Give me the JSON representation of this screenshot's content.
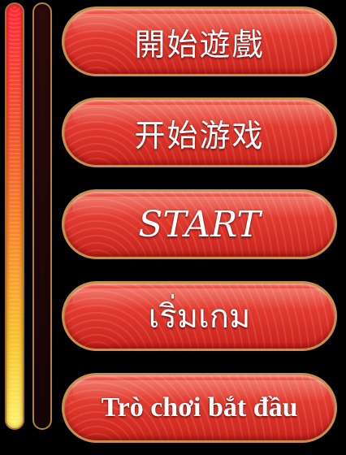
{
  "progress_bar": {
    "fill_fraction": 1.0
  },
  "buttons": [
    {
      "label": "開始遊戲"
    },
    {
      "label": "开始游戏"
    },
    {
      "label": "START"
    },
    {
      "label": "เริ่มเกม"
    },
    {
      "label": "Trò chơi bắt đầu"
    }
  ],
  "colors": {
    "button_red": "#e23a2e",
    "button_border": "#c5904d",
    "bar_top": "#ff2a3a",
    "bar_bottom": "#fff36a"
  }
}
